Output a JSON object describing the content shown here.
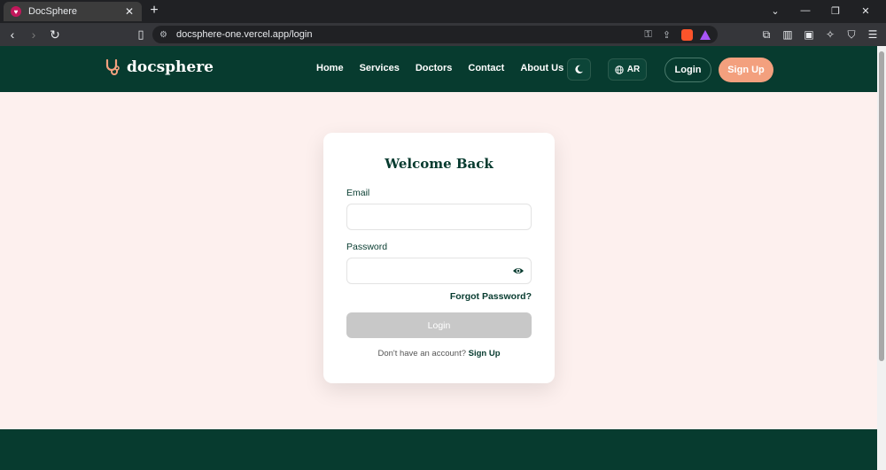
{
  "browser": {
    "tab_title": "DocSphere",
    "tab_favicon": "heart-favicon-icon",
    "url": "docsphere-one.vercel.app/login"
  },
  "header": {
    "logo_text": "docsphere",
    "logo_icon": "stethoscope-icon",
    "nav": [
      "Home",
      "Services",
      "Doctors",
      "Contact",
      "About Us"
    ],
    "theme_icon": "moon-icon",
    "lang_label": "AR",
    "lang_icon": "globe-icon",
    "login_label": "Login",
    "signup_label": "Sign Up"
  },
  "login_card": {
    "title": "Welcome Back",
    "email_label": "Email",
    "email_value": "",
    "password_label": "Password",
    "password_value": "",
    "forgot_label": "Forgot Password?",
    "submit_label": "Login",
    "prompt_text": "Don't have an account?",
    "signup_link": "Sign Up"
  },
  "colors": {
    "brand_dark": "#073b2f",
    "accent": "#f3a07e",
    "page_bg": "#fdf0ee",
    "disabled_button": "#c8c8c8"
  }
}
